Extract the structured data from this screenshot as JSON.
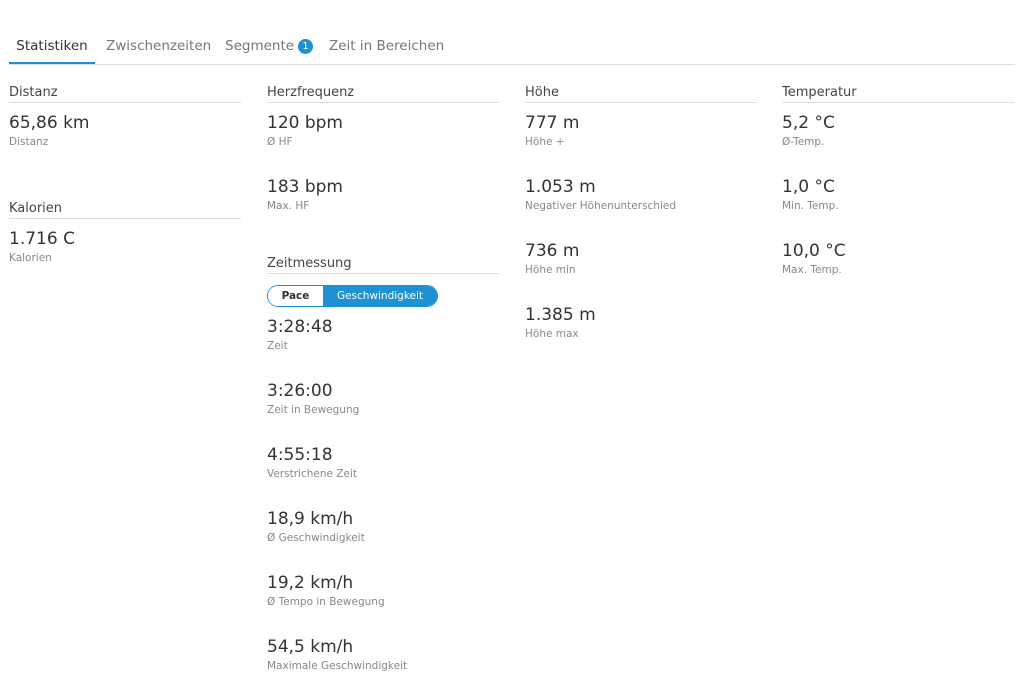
{
  "tabs": {
    "statistics": "Statistiken",
    "splits": "Zwischenzeiten",
    "segments": "Segmente",
    "segments_badge": "1",
    "time_in_zones": "Zeit in Bereichen"
  },
  "distance": {
    "header": "Distanz",
    "value": "65,86 km",
    "label": "Distanz"
  },
  "calories": {
    "header": "Kalorien",
    "value": "1.716 C",
    "label": "Kalorien"
  },
  "heart_rate": {
    "header": "Herzfrequenz",
    "avg_value": "120 bpm",
    "avg_label": "Ø HF",
    "max_value": "183 bpm",
    "max_label": "Max. HF"
  },
  "timing": {
    "header": "Zeitmessung",
    "toggle_pace": "Pace",
    "toggle_speed": "Geschwindigkeit",
    "items": [
      {
        "value": "3:28:48",
        "label": "Zeit"
      },
      {
        "value": "3:26:00",
        "label": "Zeit in Bewegung"
      },
      {
        "value": "4:55:18",
        "label": "Verstrichene Zeit"
      },
      {
        "value": "18,9 km/h",
        "label": "Ø Geschwindigkeit"
      },
      {
        "value": "19,2 km/h",
        "label": "Ø Tempo in Bewegung"
      },
      {
        "value": "54,5 km/h",
        "label": "Maximale Geschwindigkeit"
      }
    ]
  },
  "elevation": {
    "header": "Höhe",
    "items": [
      {
        "value": "777 m",
        "label": "Höhe +"
      },
      {
        "value": "1.053 m",
        "label": "Negativer Höhenunterschied"
      },
      {
        "value": "736 m",
        "label": "Höhe min"
      },
      {
        "value": "1.385 m",
        "label": "Höhe max"
      }
    ]
  },
  "temperature": {
    "header": "Temperatur",
    "items": [
      {
        "value": "5,2 °C",
        "label": "Ø-Temp."
      },
      {
        "value": "1,0 °C",
        "label": "Min. Temp."
      },
      {
        "value": "10,0 °C",
        "label": "Max. Temp."
      }
    ]
  },
  "colors": {
    "accent": "#1e90d4",
    "divider": "#dddddd",
    "muted_text": "#888888"
  }
}
